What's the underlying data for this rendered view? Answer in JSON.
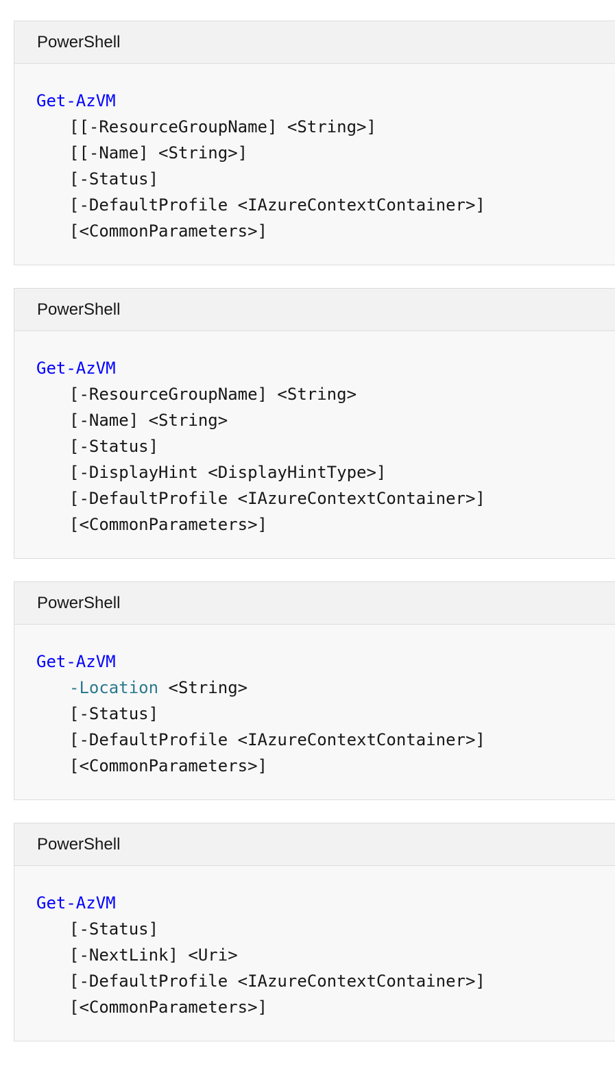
{
  "blocks": [
    {
      "language": "PowerShell",
      "command": "Get-AzVM",
      "lines": [
        {
          "text": "[[-ResourceGroupName] <String>]",
          "kind": "plain"
        },
        {
          "text": "[[-Name] <String>]",
          "kind": "plain"
        },
        {
          "text": "[-Status]",
          "kind": "plain"
        },
        {
          "text": "[-DefaultProfile <IAzureContextContainer>]",
          "kind": "plain"
        },
        {
          "text": "[<CommonParameters>]",
          "kind": "plain"
        }
      ]
    },
    {
      "language": "PowerShell",
      "command": "Get-AzVM",
      "lines": [
        {
          "text": "[-ResourceGroupName] <String>",
          "kind": "plain"
        },
        {
          "text": "[-Name] <String>",
          "kind": "plain"
        },
        {
          "text": "[-Status]",
          "kind": "plain"
        },
        {
          "text": "[-DisplayHint <DisplayHintType>]",
          "kind": "plain"
        },
        {
          "text": "[-DefaultProfile <IAzureContextContainer>]",
          "kind": "plain"
        },
        {
          "text": "[<CommonParameters>]",
          "kind": "plain"
        }
      ]
    },
    {
      "language": "PowerShell",
      "command": "Get-AzVM",
      "lines": [
        {
          "param": "-Location",
          "rest": " <String>",
          "kind": "param"
        },
        {
          "text": "[-Status]",
          "kind": "plain"
        },
        {
          "text": "[-DefaultProfile <IAzureContextContainer>]",
          "kind": "plain"
        },
        {
          "text": "[<CommonParameters>]",
          "kind": "plain"
        }
      ]
    },
    {
      "language": "PowerShell",
      "command": "Get-AzVM",
      "lines": [
        {
          "text": "[-Status]",
          "kind": "plain"
        },
        {
          "text": "[-NextLink] <Uri>",
          "kind": "plain"
        },
        {
          "text": "[-DefaultProfile <IAzureContextContainer>]",
          "kind": "plain"
        },
        {
          "text": "[<CommonParameters>]",
          "kind": "plain"
        }
      ]
    }
  ],
  "colors": {
    "command": "#0101fd",
    "parameter": "#2b7a8d",
    "text": "#171717",
    "header_bg": "#f2f2f2",
    "body_bg": "#f8f8f8",
    "border": "#dcdcdc"
  }
}
